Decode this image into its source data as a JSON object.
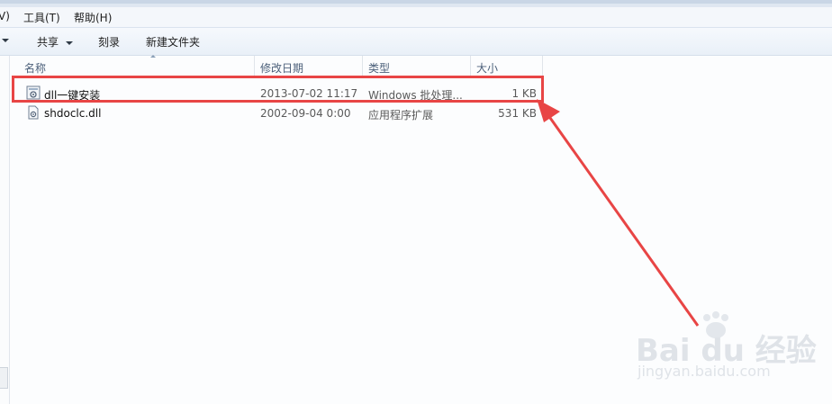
{
  "menubar": {
    "items": [
      "V)",
      "工具(T)",
      "帮助(H)"
    ]
  },
  "toolbar": {
    "share_label": "共享",
    "burn_label": "刻录",
    "new_folder_label": "新建文件夹"
  },
  "columns": {
    "name": "名称",
    "date": "修改日期",
    "type": "类型",
    "size": "大小"
  },
  "files": [
    {
      "name": "dll一键安装",
      "date": "2013-07-02 11:17",
      "type": "Windows 批处理...",
      "size": "1 KB",
      "icon": "batch-file-icon",
      "highlighted": true
    },
    {
      "name": "shdoclc.dll",
      "date": "2002-09-04 0:00",
      "type": "应用程序扩展",
      "size": "531 KB",
      "icon": "dll-file-icon",
      "highlighted": false
    }
  ],
  "colors": {
    "highlight": "#e84545",
    "header_text": "#4c607a"
  },
  "watermark": {
    "brand": "Bai du 经验",
    "url": "jingyan.baidu.com"
  }
}
